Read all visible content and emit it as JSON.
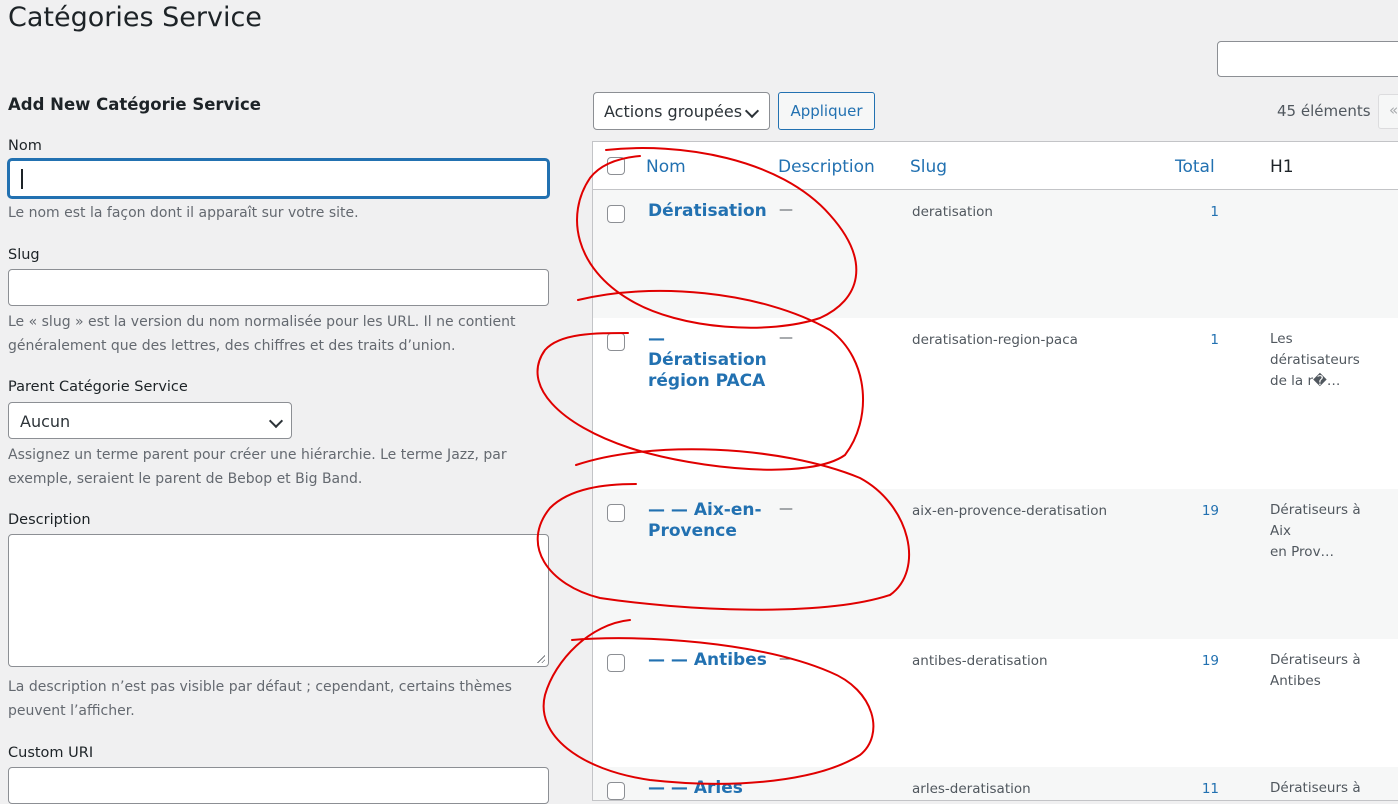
{
  "page": {
    "title": "Catégories Service"
  },
  "form": {
    "heading": "Add New Catégorie Service",
    "name_label": "Nom",
    "name_value": "",
    "name_help": "Le nom est la façon dont il apparaît sur votre site.",
    "slug_label": "Slug",
    "slug_value": "",
    "slug_help_1": "Le « slug » est la version du nom normalisée pour les URL. Il ne contient",
    "slug_help_2": "généralement que des lettres, des chiffres et des traits d’union.",
    "parent_label": "Parent Catégorie Service",
    "parent_selected": "Aucun",
    "parent_help_1": "Assignez un terme parent pour créer une hiérarchie. Le terme Jazz, par",
    "parent_help_2": "exemple, seraient le parent de Bebop et Big Band.",
    "description_label": "Description",
    "description_value": "",
    "description_help_1": "La description n’est pas visible par défaut ; cependant, certains thèmes",
    "description_help_2": "peuvent l’afficher.",
    "custom_uri_label": "Custom URI"
  },
  "toolbar": {
    "bulk_actions": "Actions groupées",
    "apply_label": "Appliquer",
    "items_count": "45 éléments",
    "pager_first": "«"
  },
  "table": {
    "columns": {
      "name": "Nom",
      "description": "Description",
      "slug": "Slug",
      "total": "Total",
      "h1": "H1"
    },
    "rows": [
      {
        "name_lines": [
          "Dératisation"
        ],
        "description": "—",
        "slug": "deratisation",
        "total": "1",
        "h1_lines": []
      },
      {
        "name_lines": [
          "—",
          "Dératisation",
          "région PACA"
        ],
        "description": "—",
        "slug": "deratisation-region-paca",
        "total": "1",
        "h1_lines": [
          "Les dératisateurs",
          "de la r�…"
        ]
      },
      {
        "name_lines": [
          "— — Aix-en-",
          "Provence"
        ],
        "description": "—",
        "slug": "aix-en-provence-deratisation",
        "total": "19",
        "h1_lines": [
          "Dératiseurs à Aix",
          "en Prov…"
        ]
      },
      {
        "name_lines": [
          "— — Antibes"
        ],
        "description": "—",
        "slug": "antibes-deratisation",
        "total": "19",
        "h1_lines": [
          "Dératiseurs à",
          "Antibes"
        ]
      },
      {
        "name_lines": [
          "— — Arles"
        ],
        "description": "",
        "slug": "arles-deratisation",
        "total": "11",
        "h1_lines": [
          "Dératiseurs à"
        ]
      }
    ]
  },
  "colors": {
    "link": "#2271b1",
    "annotation": "#e00000",
    "background": "#f0f0f1"
  }
}
